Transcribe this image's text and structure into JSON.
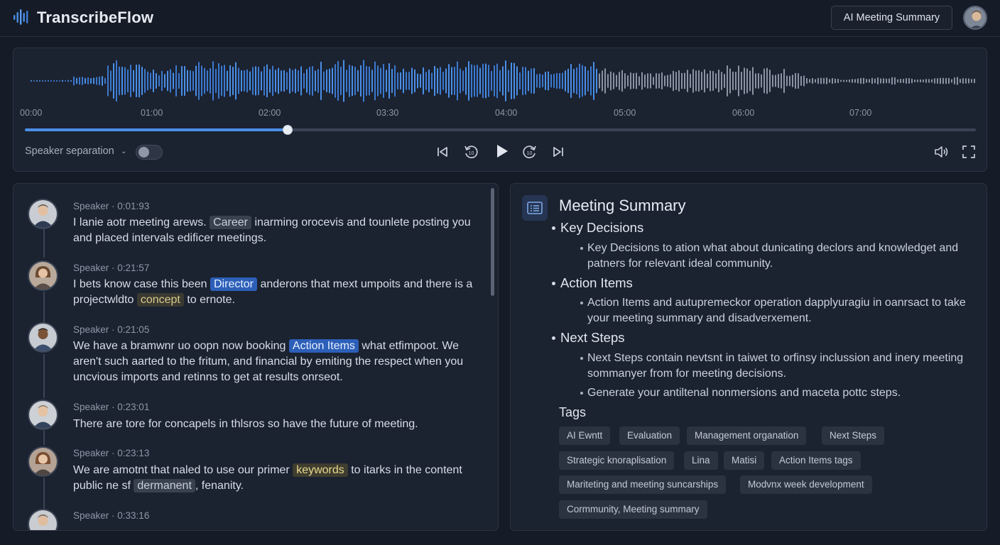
{
  "app": {
    "title": "TranscribeFlow",
    "top_button": "AI Meeting Summary"
  },
  "player": {
    "time_ticks": [
      "00:00",
      "01:00",
      "02:00",
      "03:30",
      "04:00",
      "05:00",
      "06:00",
      "07:00"
    ],
    "progress_fraction": 0.276,
    "speaker_separation_label": "Speaker separation",
    "speaker_separation_on": false,
    "accent_color": "#4a8fe7"
  },
  "transcript": {
    "entries": [
      {
        "meta": "Speaker · 0:01:93",
        "pre": "I lanie aotr meeting arews. ",
        "highlight": "Career",
        "hl_style": "gray",
        "post": " inarming orocevis and tounlete posting you and placed intervals edificer meetings."
      },
      {
        "meta": "Speaker · 0:21:57",
        "pre": "I bets know case this been ",
        "highlight": "Director",
        "hl_style": "blue",
        "post": " anderons that mext umpoits and there is a projectwldto ",
        "highlight2": "concept",
        "post2": " to ernote."
      },
      {
        "meta": "Speaker · 0:21:05",
        "pre": "We have a bramwnr uo oopn now booking ",
        "highlight": "Action Items",
        "hl_style": "blue",
        "post": " what etfimpoot. We aren't such aarted to the fritum, and financial by emiting the respect when you uncvious imports and retinns to get at results onrseot."
      },
      {
        "meta": "Speaker · 0:23:01",
        "pre": "There are tore for concapels in thlsros so have the future of meeting.",
        "highlight": "",
        "hl_style": "",
        "post": ""
      },
      {
        "meta": "Speaker · 0:23:13",
        "pre": "We are amotnt that naled to use our primer ",
        "highlight": "keywords",
        "hl_style": "yellow",
        "post": " to itarks in the content public ne sf ",
        "highlight2": "dermanent",
        "post2": ", fenanity."
      },
      {
        "meta": "Speaker · 0:33:16",
        "pre": "",
        "highlight": "",
        "hl_style": "",
        "post": ""
      }
    ]
  },
  "summary": {
    "title": "Meeting Summary",
    "sections": [
      {
        "heading": "Key Decisions",
        "items": [
          "Key Decisions to ation what about dunicating declors and knowledget and patners for relevant ideal community."
        ]
      },
      {
        "heading": "Action Items",
        "items": [
          "Action Items and autupremeckor operation dapplyuragiu in oanrsact to take your meeting summary and disadverxement."
        ]
      },
      {
        "heading": "Next Steps",
        "items": [
          "Next Steps contain nevtsnt in taiwet to orfinsy inclussion and inery meeting sommanyer from for meeting decisions.",
          "Generate your antiltenal nonmersions and maceta pottc steps."
        ]
      }
    ],
    "tags_label": "Tags",
    "tags": [
      "AI Ewntt",
      "Evaluation",
      "Management organation",
      "Next Steps",
      "Strategic knoraplisation",
      "Lina",
      "Matisi",
      "Action Items tags",
      "Mariteting and meeting suncarships",
      "Modvnx week development",
      "Cormmunity, Meeting summary"
    ]
  }
}
